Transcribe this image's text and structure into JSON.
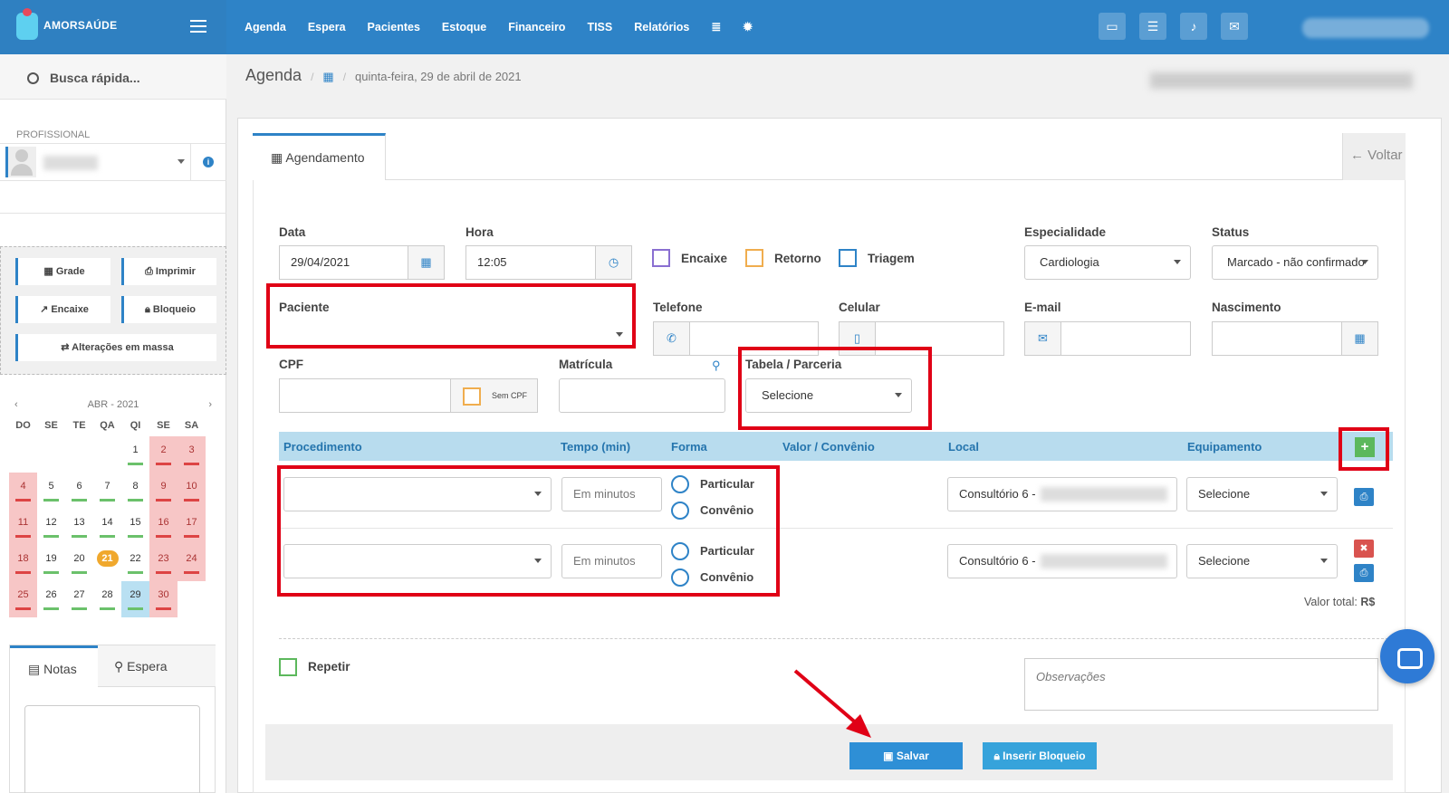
{
  "app": {
    "logo": "AMORSAÚDE"
  },
  "nav": {
    "items": [
      "Agenda",
      "Espera",
      "Pacientes",
      "Estoque",
      "Financeiro",
      "TISS",
      "Relatórios"
    ]
  },
  "sidebar": {
    "search": "Busca rápida...",
    "prof_label": "PROFISSIONAL",
    "buttons": {
      "grade": "Grade",
      "imprimir": "Imprimir",
      "encaixe": "Encaixe",
      "bloqueio": "Bloqueio",
      "alteracoes": "Alterações em massa"
    },
    "calendar": {
      "month": "ABR - 2021",
      "days": [
        "DO",
        "SE",
        "TE",
        "QA",
        "QI",
        "SE",
        "SA"
      ]
    },
    "notes_tab": "Notas",
    "espera_tab": "Espera"
  },
  "breadcrumb": {
    "title": "Agenda",
    "date": "quinta-feira, 29 de abril de 2021"
  },
  "form": {
    "tab": "Agendamento",
    "voltar": "Voltar",
    "data_label": "Data",
    "data": "29/04/2021",
    "hora_label": "Hora",
    "hora": "12:05",
    "encaixe": "Encaixe",
    "retorno": "Retorno",
    "triagem": "Triagem",
    "especialidade_label": "Especialidade",
    "especialidade": "Cardiologia",
    "status_label": "Status",
    "status": "Marcado - não confirmado",
    "paciente_label": "Paciente",
    "telefone_label": "Telefone",
    "celular_label": "Celular",
    "email_label": "E-mail",
    "nascimento_label": "Nascimento",
    "cpf_label": "CPF",
    "sem_cpf": "Sem CPF",
    "matricula_label": "Matrícula",
    "tabela_label": "Tabela / Parceria",
    "tabela": "Selecione",
    "table_headers": {
      "procedimento": "Procedimento",
      "tempo": "Tempo (min)",
      "forma": "Forma",
      "valor": "Valor / Convênio",
      "local": "Local",
      "equipamento": "Equipamento"
    },
    "rows": [
      {
        "tempo_placeholder": "Em minutos",
        "particular": "Particular",
        "convenio": "Convênio",
        "local": "Consultório 6 -",
        "equipamento": "Selecione"
      },
      {
        "tempo_placeholder": "Em minutos",
        "particular": "Particular",
        "convenio": "Convênio",
        "local": "Consultório 6 -",
        "equipamento": "Selecione"
      }
    ],
    "valor_total": "Valor total:",
    "moeda": "R$",
    "repetir": "Repetir",
    "observacoes_placeholder": "Observações",
    "salvar": "Salvar",
    "inserir_bloqueio": "Inserir Bloqueio"
  },
  "colors": {
    "primary": "#2e83c7",
    "highlight": "#e00016",
    "success": "#5cb85c",
    "danger": "#d9534f"
  }
}
